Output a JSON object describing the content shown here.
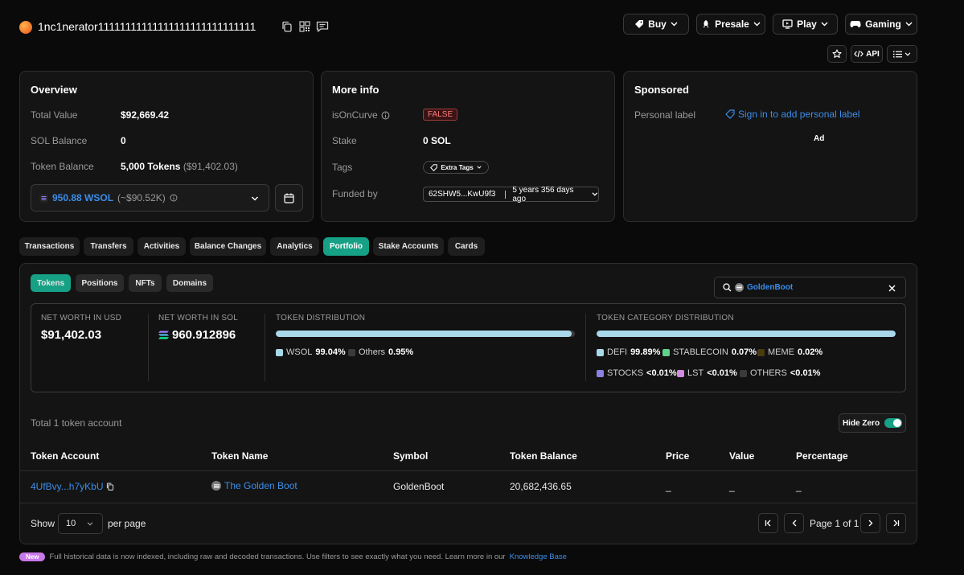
{
  "header": {
    "address": "1nc1nerator11111111111111111111111111111",
    "menus": [
      {
        "label": "Buy"
      },
      {
        "label": "Presale"
      },
      {
        "label": "Play"
      },
      {
        "label": "Gaming"
      }
    ],
    "api_label": "API"
  },
  "overview": {
    "title": "Overview",
    "total_value_label": "Total Value",
    "total_value": "$92,669.42",
    "sol_balance_label": "SOL Balance",
    "sol_balance": "0",
    "token_balance_label": "Token Balance",
    "token_balance": "5,000 Tokens",
    "token_balance_usd": "($91,402.03)",
    "wsol_amount": "950.88 WSOL",
    "wsol_usd": "(~$90.52K)"
  },
  "more_info": {
    "title": "More info",
    "is_on_curve_label": "isOnCurve",
    "is_on_curve_value": "FALSE",
    "stake_label": "Stake",
    "stake_value": "0 SOL",
    "tags_label": "Tags",
    "tags_value": "Extra Tags",
    "funded_by_label": "Funded by",
    "funded_by_address": "62SHW5...KwU9f3",
    "funded_by_age": "5 years 356 days ago"
  },
  "sponsored": {
    "title": "Sponsored",
    "personal_label": "Personal label",
    "sign_in_text": "Sign in to add personal label",
    "ad": "Ad"
  },
  "tabs": [
    {
      "label": "Transactions"
    },
    {
      "label": "Transfers"
    },
    {
      "label": "Activities"
    },
    {
      "label": "Balance Changes"
    },
    {
      "label": "Analytics"
    },
    {
      "label": "Portfolio"
    },
    {
      "label": "Stake Accounts"
    },
    {
      "label": "Cards"
    }
  ],
  "portfolio": {
    "subtabs": [
      {
        "label": "Tokens"
      },
      {
        "label": "Positions"
      },
      {
        "label": "NFTs"
      },
      {
        "label": "Domains"
      }
    ],
    "search_value": "GoldenBoot",
    "net_worth_usd_label": "NET WORTH IN USD",
    "net_worth_usd": "$91,402.03",
    "net_worth_sol_label": "NET WORTH IN SOL",
    "net_worth_sol": "960.912896",
    "token_distribution_label": "TOKEN DISTRIBUTION",
    "token_distribution": [
      {
        "name": "WSOL",
        "pct": "99.04%",
        "fraction": 0.9904,
        "color": "#a8d8ea"
      },
      {
        "name": "Others",
        "pct": "0.95%",
        "fraction": 0.0095,
        "color": "#3a3a3a"
      }
    ],
    "category_distribution_label": "TOKEN CATEGORY DISTRIBUTION",
    "category_distribution": [
      {
        "name": "DEFI",
        "pct": "99.89%",
        "fraction": 0.9989,
        "color": "#a8d8ea"
      },
      {
        "name": "STABLECOIN",
        "pct": "0.07%",
        "color": "#5fd38d"
      },
      {
        "name": "MEME",
        "pct": "0.02%",
        "color": "#4a3a10"
      },
      {
        "name": "STOCKS",
        "pct": "<0.01%",
        "color": "#8b7fe0"
      },
      {
        "name": "LST",
        "pct": "<0.01%",
        "color": "#d08be0"
      },
      {
        "name": "OTHERS",
        "pct": "<0.01%",
        "color": "#3a3a3a"
      }
    ],
    "total_accounts": "Total 1 token account",
    "hide_zero_label": "Hide Zero",
    "columns": [
      "Token Account",
      "Token Name",
      "Symbol",
      "Token Balance",
      "Price",
      "Value",
      "Percentage"
    ],
    "rows": [
      {
        "account": "4UfBvy...h7yKbU",
        "name": "The Golden Boot",
        "symbol": "GoldenBoot",
        "balance": "20,682,436.65",
        "price": "_",
        "value": "_",
        "percentage": "_"
      }
    ],
    "show_label": "Show",
    "page_size": "10",
    "per_page_label": "per page",
    "page_info": "Page 1 of 1"
  },
  "footer": {
    "badge": "New",
    "text": "Full historical data is now indexed, including raw and decoded transactions. Use filters to see exactly what you need. Learn more in our",
    "link": "Knowledge Base"
  }
}
